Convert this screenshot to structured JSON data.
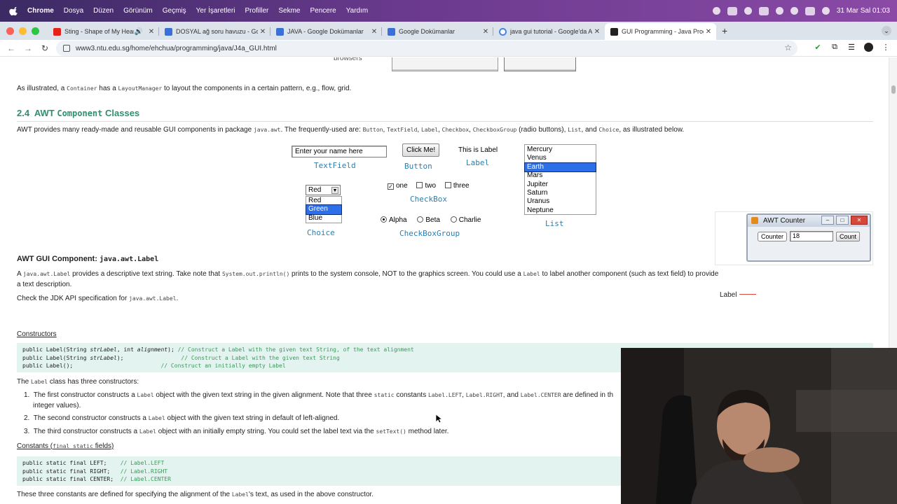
{
  "menubar": {
    "items": [
      "Chrome",
      "Dosya",
      "Düzen",
      "Görünüm",
      "Geçmiş",
      "Yer İşaretleri",
      "Profiller",
      "Sekme",
      "Pencere",
      "Yardım"
    ],
    "datetime": "31 Mar Sal  01:03"
  },
  "tabs": [
    {
      "title": "Sting - Shape of My Heart",
      "fav_color": "#e62117"
    },
    {
      "title": "DOSYAL ağ soru havuzu - Go",
      "fav_color": "#3b6fd8"
    },
    {
      "title": "JAVA - Google Dokümanlar",
      "fav_color": "#3b6fd8"
    },
    {
      "title": "Google Dokümanlar",
      "fav_color": "#3b6fd8"
    },
    {
      "title": "java gui tutorial - Google'da A",
      "fav_color": "#4285f4"
    },
    {
      "title": "GUI Programming - Java Prog",
      "fav_color": "#222222"
    }
  ],
  "address": "www3.ntu.edu.sg/home/ehchua/programming/java/J4a_GUI.html",
  "page": {
    "top_cut_label": "browsers",
    "intro_parts": [
      "As illustrated, a ",
      "Container",
      " has a ",
      "LayoutManager",
      " to layout the components in a certain pattern, e.g., flow, grid."
    ],
    "section_number": "2.4",
    "section_awt": "AWT",
    "section_mono": "Component",
    "section_tail": "Classes",
    "provides_parts": [
      "AWT provides many ready-made and reusable GUI components in package ",
      "java.awt",
      ". The frequently-used are: ",
      "Button",
      ", ",
      "TextField",
      ", ",
      "Label",
      ", ",
      "Checkbox",
      ", ",
      "CheckboxGroup",
      " (radio buttons), ",
      "List",
      ", and ",
      "Choice",
      ", as illustrated below."
    ],
    "figure": {
      "textfield_value": "Enter your name here",
      "button_label": "Click Me!",
      "label_text": "This is Label",
      "captions": {
        "textfield": "TextField",
        "button": "Button",
        "label": "Label",
        "checkbox": "CheckBox",
        "checkboxgroup": "CheckBoxGroup",
        "choice": "Choice",
        "list": "List"
      },
      "choice_selected": "Red",
      "choice_options": [
        "Red",
        "Green",
        "Blue"
      ],
      "checkboxes": [
        {
          "label": "one",
          "checked": true
        },
        {
          "label": "two",
          "checked": false
        },
        {
          "label": "three",
          "checked": false
        }
      ],
      "radios": [
        {
          "label": "Alpha",
          "checked": true
        },
        {
          "label": "Beta",
          "checked": false
        },
        {
          "label": "Charlie",
          "checked": false
        }
      ],
      "list_items": [
        "Mercury",
        "Venus",
        "Earth",
        "Mars",
        "Jupiter",
        "Saturn",
        "Uranus",
        "Neptune"
      ],
      "list_selected": "Earth"
    },
    "label_heading_text": "AWT GUI Component: ",
    "label_heading_mono": "java.awt.Label",
    "label_desc1_parts": [
      "A ",
      "java.awt.Label",
      " provides a descriptive text string. Take note that ",
      "System.out.println()",
      " prints to the system console, NOT to the graphics screen. You could use a ",
      "Label",
      " to label another component (such as text field) to provide"
    ],
    "label_desc2": "a text description.",
    "label_desc3_parts": [
      "Check the JDK API specification for ",
      "java.awt.Label",
      "."
    ],
    "awt_counter": {
      "side_label": "Label",
      "title": "AWT Counter",
      "counter_label": "Counter",
      "value": "18",
      "button": "Count"
    },
    "constructors_heading": "Constructors",
    "constructors_code": [
      {
        "code_a": "public Label(String ",
        "code_it": "strLabel",
        "code_b": ", int ",
        "code_it2": "alignment",
        "code_c": ");",
        "comment": "// Construct a Label with the given text String, of the text alignment"
      },
      {
        "code_a": "public Label(String ",
        "code_it": "strLabel",
        "code_b": ");",
        "code_it2": "",
        "code_c": "",
        "comment": "// Construct a Label with the given text String"
      },
      {
        "code_a": "public Label();",
        "code_it": "",
        "code_b": "",
        "code_it2": "",
        "code_c": "",
        "comment": "// Construct an initially empty Label"
      }
    ],
    "three_constructors_parts": [
      "The ",
      "Label",
      " class has three constructors:"
    ],
    "list_items": [
      [
        "The first constructor constructs a ",
        "Label",
        " object with the given text string in the given alignment. Note that three ",
        "static",
        " constants ",
        "Label.LEFT",
        ", ",
        "Label.RIGHT",
        ", and ",
        "Label.CENTER",
        " are defined in th"
      ],
      [
        "The second constructor constructs a ",
        "Label",
        " object with the given text string in default of left-aligned."
      ],
      [
        "The third constructor constructs a ",
        "Label",
        " object with an initially empty string. You could set the label text via the ",
        "setText()",
        " method later."
      ]
    ],
    "list_item1_wrap": "integer values).",
    "constants_heading_a": "Constants (",
    "constants_heading_mono": "final static",
    "constants_heading_b": " fields)",
    "constants_code": [
      {
        "code": "public static final LEFT;    ",
        "comment": "// Label.LEFT"
      },
      {
        "code": "public static final RIGHT;   ",
        "comment": "// Label.RIGHT"
      },
      {
        "code": "public static final CENTER;  ",
        "comment": "// Label.CENTER"
      }
    ],
    "closing_parts": [
      "These three constants are defined for specifying the alignment of the ",
      "Label",
      "'s text, as used in the above constructor."
    ]
  }
}
